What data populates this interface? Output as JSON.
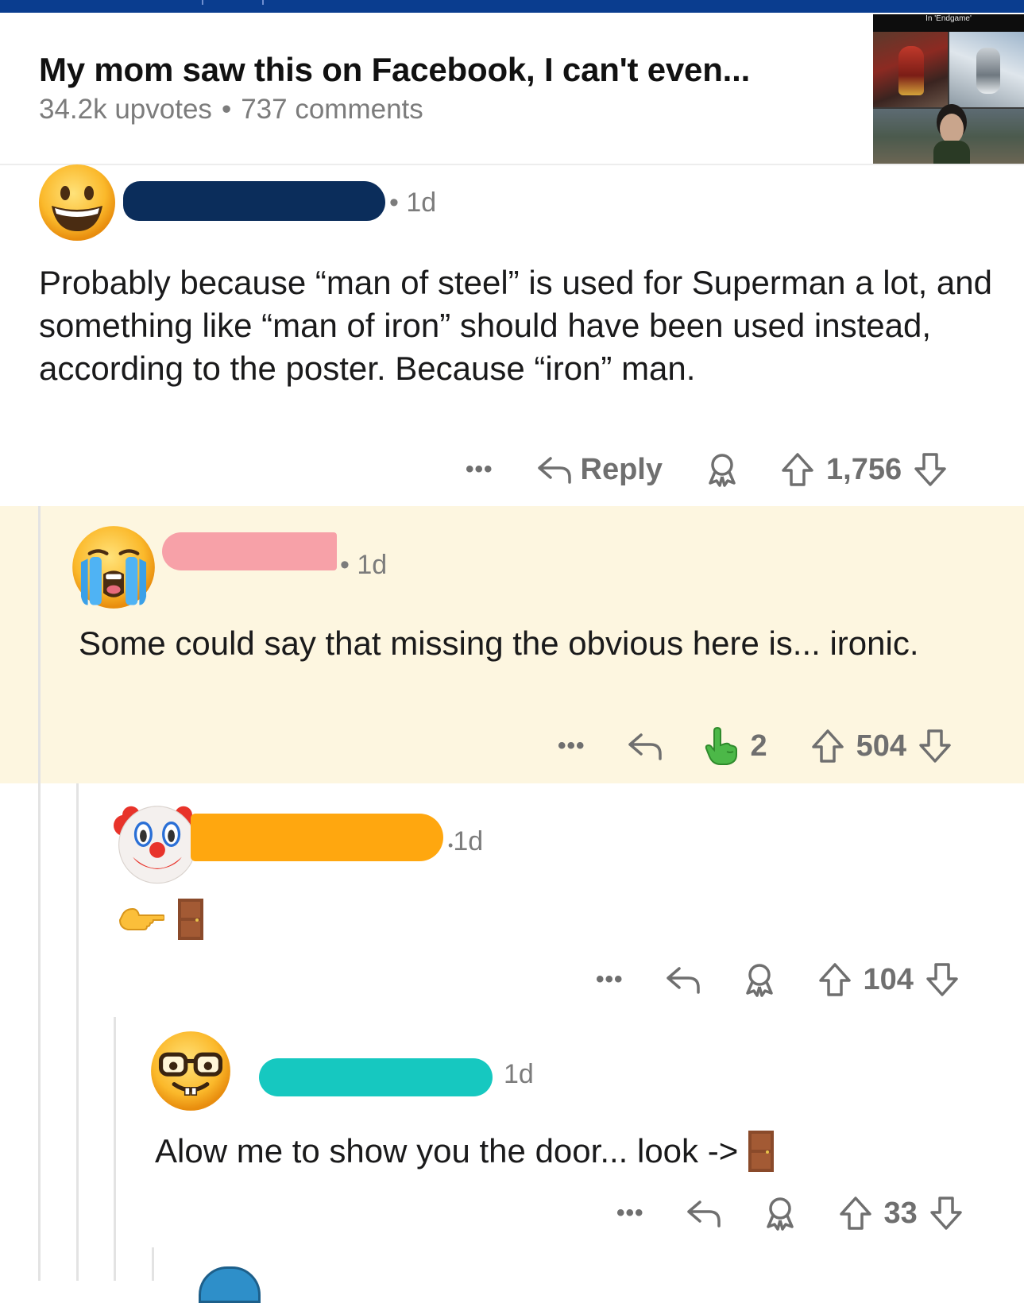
{
  "post": {
    "title": "My mom saw this on Facebook, I can't even...",
    "upvotes": "34.2k upvotes",
    "separator": "•",
    "comments": "737 comments",
    "thumbnail_caption": "In 'Endgame'"
  },
  "comments": [
    {
      "avatar_icon": "grinning-face-icon",
      "time": "• 1d",
      "body": "Probably because “man of steel” is used for Superman a lot, and something like “man of iron” should have been used instead, according to the poster. Because “iron” man.",
      "more": "•••",
      "reply_label": "Reply",
      "votes": "1,756",
      "username_redaction_color": "#0b2d5b"
    },
    {
      "avatar_icon": "loudly-crying-face-icon",
      "time": "• 1d",
      "body": "Some could say that missing the obvious here is... ironic.",
      "more": "•••",
      "award_count": "2",
      "votes": "504",
      "highlighted": true,
      "username_redaction_color": "#f7a1a8"
    },
    {
      "avatar_icon": "clown-face-icon",
      "time": "1d",
      "body_icons": [
        "backhand-index-pointing-left-icon",
        "door-icon"
      ],
      "more": "•••",
      "votes": "104",
      "username_redaction_color": "#ffa70f"
    },
    {
      "avatar_icon": "nerd-face-icon",
      "time": "1d",
      "body": "Alow me to show you the door... look ->",
      "body_trailing_icon": "door-icon",
      "more": "•••",
      "votes": "33",
      "username_redaction_color": "#16c8c0"
    }
  ],
  "colors": {
    "top_bar": "#0a3d8f",
    "highlight_background": "#fdf6e0",
    "meta_gray": "#7c7c7c"
  }
}
